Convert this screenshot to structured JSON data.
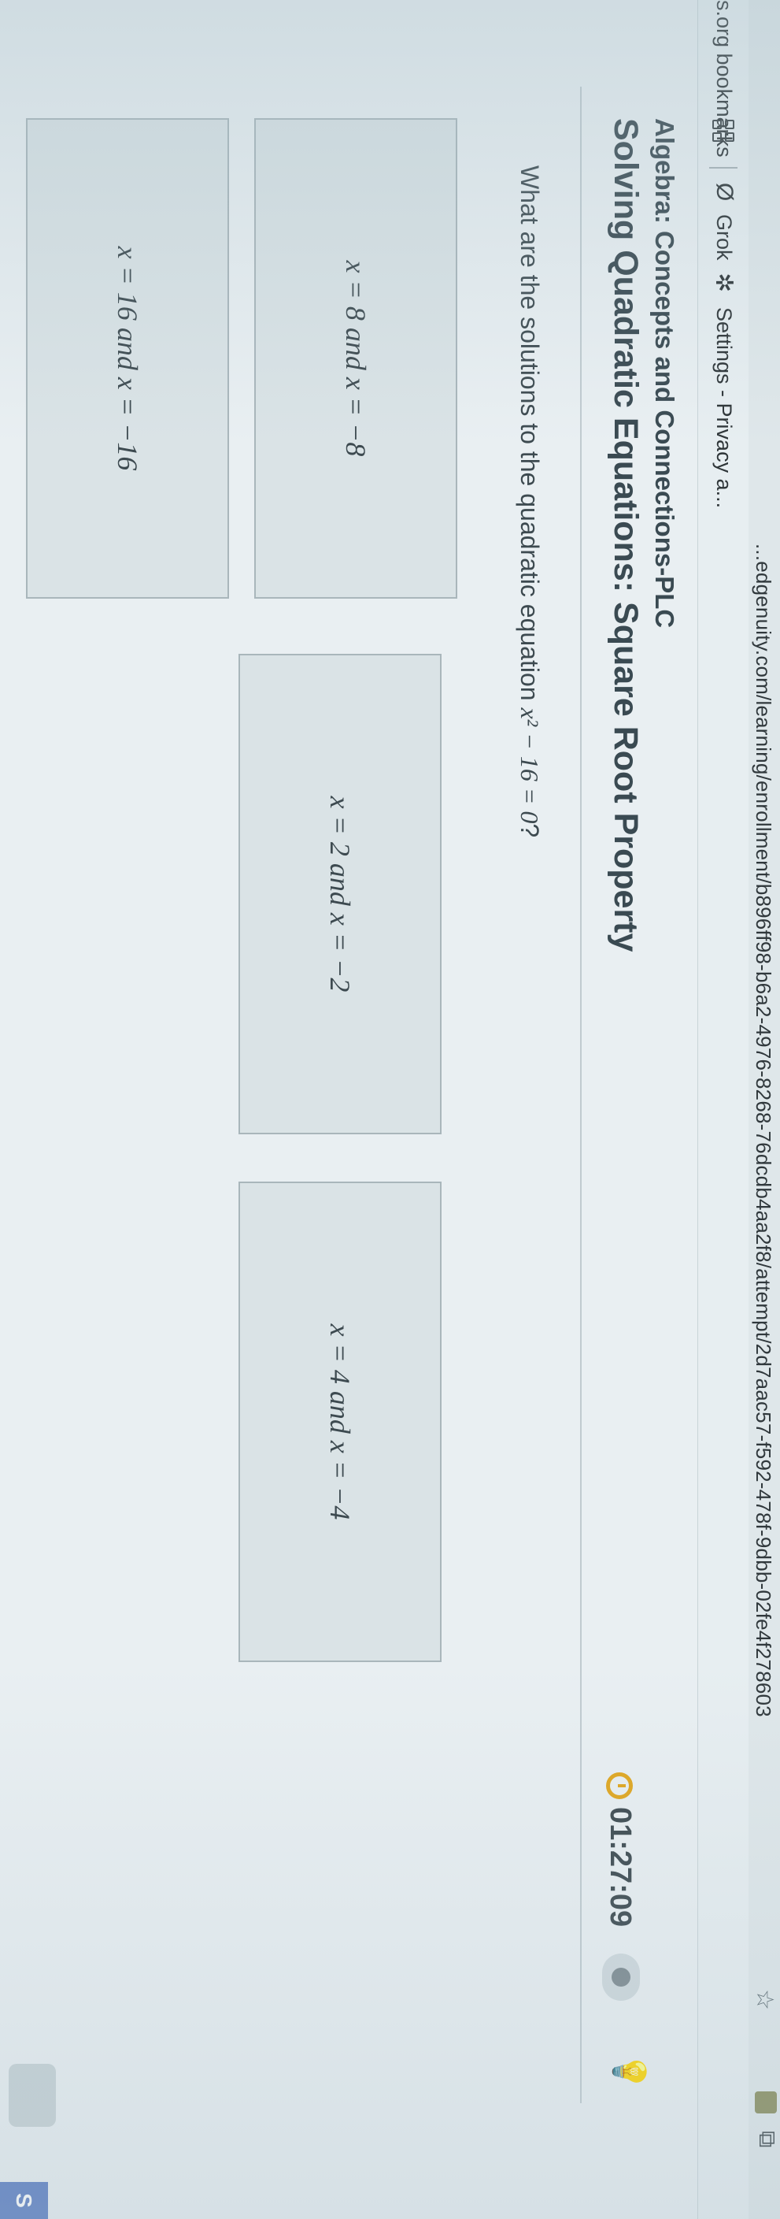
{
  "browser": {
    "url": "...edgenuity.com/learning/enrollment/b896ff98-b6a2-4976-8268-76dcdb4aa2f8/attempt/2d7aac57-f592-478f-9dbb-02fe4f278603",
    "bookmarks": [
      {
        "label": "s.org bookmarks"
      },
      {
        "label": "Grok"
      },
      {
        "label": "Settings - Privacy a..."
      }
    ]
  },
  "header": {
    "course": "Algebra: Concepts and Connections-PLC",
    "lesson": "Solving Quadratic Equations: Square Root Property",
    "timer": "01:27:09"
  },
  "question": {
    "prefix": "What are the solutions to the quadratic equation ",
    "equation": "x² − 16 = 0",
    "suffix": "?"
  },
  "choices": [
    {
      "label": "x = 8 and x = −8"
    },
    {
      "label": "x = 16 and x = −16"
    },
    {
      "label": "x = 2 and x = −2"
    },
    {
      "label": "x = 4 and x = −4"
    }
  ],
  "side_tab": {
    "label": "S"
  },
  "colors": {
    "timer_icon": "#e0a620",
    "side_tab": "#5a7cc2"
  },
  "icons": {
    "bookmark_apps": "grid-icon",
    "grok": "grok-icon",
    "settings": "gear-icon",
    "bookmark_star": "star-icon",
    "timer": "clock-icon",
    "hint": "lightbulb-icon"
  }
}
